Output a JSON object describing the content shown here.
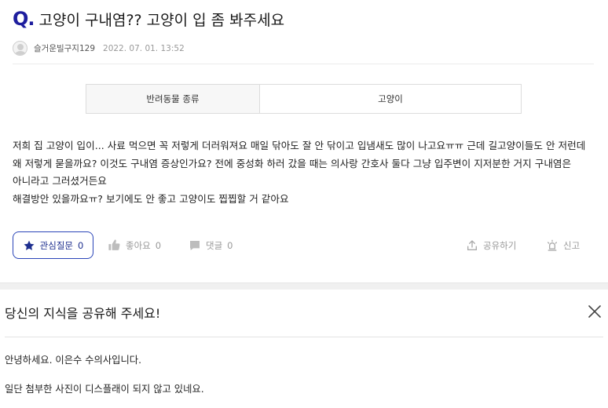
{
  "question": {
    "q_mark": "Q.",
    "title": "고양이 구내염?? 고양이 입 좀 봐주세요",
    "author": "슬거운빌구지129",
    "date": "2022. 07. 01. 13:52"
  },
  "category": {
    "key": "반려동물 종류",
    "value": "고양이"
  },
  "body": {
    "paragraph1": "저희 집 고양이 입이... 사료 먹으면 꼭 저렇게 더러워져요 매일 닦아도 잘 안 닦이고 입냄새도 많이 나고요ㅠㅠ 근데 길고양이들도 안 저런데 왜 저렇게 묻을까요? 이것도 구내염 증상인가요? 전에 중성화 하러 갔을 때는 의사랑 간호사 둘다 그냥 입주변이 지저분한 거지 구내염은 아니라고 그러셨거든요",
    "paragraph2": "해결방안 있을까요ㅠ? 보기에도 안 좋고 고양이도 찝찝할 거 같아요"
  },
  "actions": {
    "interest_label": "관심질문",
    "interest_count": "0",
    "like_label": "좋아요",
    "like_count": "0",
    "comment_label": "댓글",
    "comment_count": "0",
    "share_label": "공유하기",
    "report_label": "신고"
  },
  "answer": {
    "heading": "당신의 지식을 공유해 주세요!",
    "line1": "안녕하세요. 이은수 수의사입니다.",
    "line2": "일단 첨부한 사진이 디스플래이 되지 않고 있네요."
  },
  "icons": {
    "interest": "star-icon",
    "like": "thumbs-up-icon",
    "comment": "speech-bubble-icon",
    "share": "share-icon",
    "report": "siren-icon",
    "close": "close-icon"
  },
  "colors": {
    "accent": "#1e2f8f",
    "q_mark": "#1e1e9e",
    "muted": "#999999"
  }
}
